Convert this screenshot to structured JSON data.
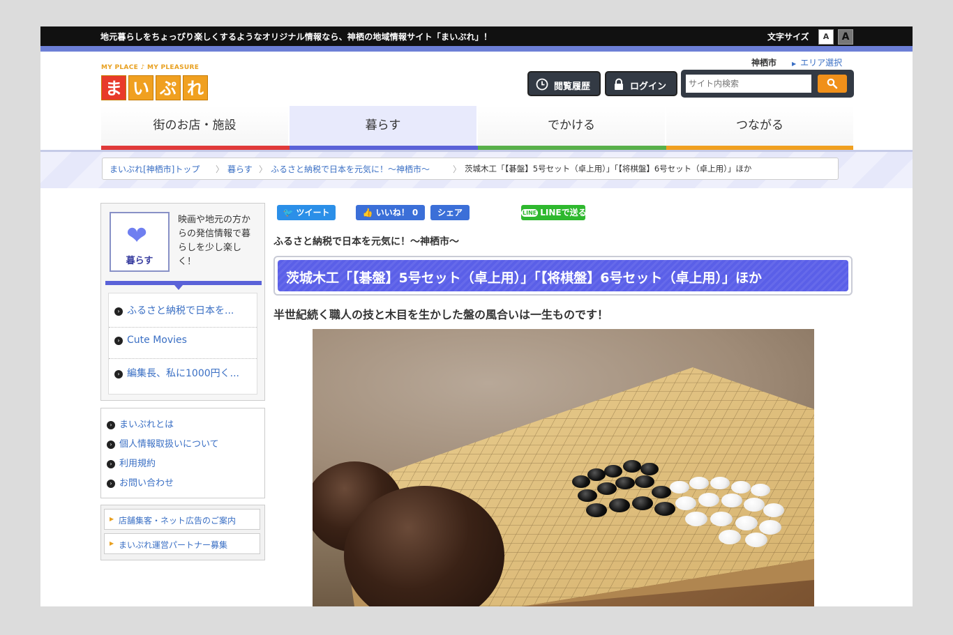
{
  "topbar": {
    "message": "地元暮らしをちょっぴり楽しくするようなオリジナル情報なら、神栖の地域情報サイト「まいぷれ」！",
    "font_size_label": "文字サイズ",
    "font_small": "A",
    "font_large": "A"
  },
  "logo": {
    "tagline": "MY PLACE ♪ MY PLEASURE",
    "chars": [
      "ま",
      "い",
      "ぷ",
      "れ"
    ]
  },
  "header": {
    "city": "神栖市",
    "area_select": "エリア選択",
    "history_button": "閲覧履歴",
    "login_button": "ログイン",
    "search_placeholder": "サイト内検索",
    "search_icon": "search-icon"
  },
  "nav": {
    "items": [
      {
        "label": "街のお店・施設",
        "color": "#e03a3a"
      },
      {
        "label": "暮らす",
        "color": "#5a62d8"
      },
      {
        "label": "でかける",
        "color": "#58b04a"
      },
      {
        "label": "つながる",
        "color": "#f0a020"
      }
    ]
  },
  "breadcrumb": {
    "items": [
      "まいぷれ[神栖市]トップ",
      "暮らす",
      "ふるさと納税で日本を元気に！〜神栖市〜",
      "茨城木工「【碁盤】5号セット（卓上用）」「【将棋盤】6号セット（卓上用）」ほか"
    ]
  },
  "sidebar": {
    "category_label": "暮らす",
    "category_desc": "映画や地元の方からの発信情報で暮らしを少し楽しく！",
    "links": [
      "ふるさと納税で日本を...",
      "Cute Movies",
      "編集長、私に1000円く..."
    ],
    "info_links": [
      "まいぷれとは",
      "個人情報取扱いについて",
      "利用規約",
      "お問い合わせ"
    ],
    "banners": [
      "店舗集客・ネット広告のご案内",
      "まいぷれ運営パートナー募集"
    ]
  },
  "social": {
    "tweet": "ツイート",
    "like": "いいね！ 0",
    "share": "シェア",
    "line": "LINEで送る"
  },
  "article": {
    "series": "ふるさと納税で日本を元気に！〜神栖市〜",
    "title": "茨城木工「【碁盤】5号セット（卓上用）」「【将棋盤】6号セット（卓上用）」ほか",
    "lead": "半世紀続く職人の技と木目を生かした盤の風合いは一生ものです！"
  },
  "colors": {
    "accent": "#5a5fe8",
    "link": "#3a6fc4",
    "topbar": "#111111",
    "orange": "#f0901a"
  }
}
